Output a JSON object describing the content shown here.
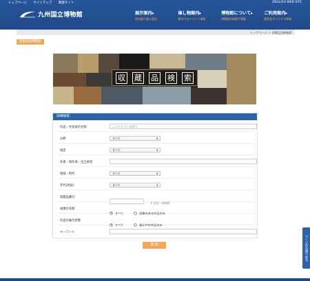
{
  "header": {
    "top_links": [
      "トップページ",
      "サイトマップ",
      "関連サイト"
    ],
    "english": "ENGLISH WEB SITE",
    "logo_text": "九州国立博物館",
    "nav": [
      {
        "label": "展示案内▸",
        "sub": "特別展や展示案内"
      },
      {
        "label": "催し物案内▸",
        "sub": "館内でのイベント情報"
      },
      {
        "label": "博物館について▸",
        "sub": "博物館の概要や事業"
      },
      {
        "label": "ご利用案内▸",
        "sub": "観覧料やアクセス情報"
      }
    ]
  },
  "breadcrumb": "トップページ ＞ 収蔵品詳細検索",
  "page_badge": "収蔵品詳細検索",
  "banner": {
    "title_chars": [
      "収",
      "蔵",
      "品",
      "検",
      "索"
    ],
    "title": "収蔵品検索"
  },
  "form": {
    "heading": "詳細検索",
    "rows": [
      {
        "label": "作品・文化財の名称",
        "type": "text",
        "placeholder": "よみがなでも検索可"
      },
      {
        "label": "分野",
        "type": "select",
        "value": "すべて"
      },
      {
        "label": "指定",
        "type": "select",
        "value": "すべて"
      },
      {
        "label": "作者・制作地・出土地等",
        "type": "text",
        "placeholder": ""
      },
      {
        "label": "地域・時代",
        "type": "select",
        "value": "すべて"
      },
      {
        "label": "年代(西紀)",
        "type": "select",
        "value": "すべて"
      },
      {
        "label": "収蔵品番号",
        "type": "text-short",
        "placeholder": "",
        "note": "※ 完全一致検索"
      },
      {
        "label": "画像の有無",
        "type": "radio",
        "options": [
          "すべて",
          "画像のある作品のみ"
        ],
        "selected": 0
      },
      {
        "label": "作品の展示状態",
        "type": "radio",
        "options": [
          "すべて",
          "展示中の作品のみ"
        ],
        "selected": 0
      },
      {
        "label": "キーワード",
        "type": "text",
        "placeholder": ""
      }
    ],
    "submit": "検 索"
  },
  "page_top": "ページの先頭へ戻る",
  "colors": {
    "header_blue": "#27569a",
    "accent_orange": "#f2a65a",
    "panel_blue": "#2d63a8"
  },
  "icons": {
    "select_arrow": "select-arrow-icon",
    "logo_mark": "museum-logo-icon"
  }
}
